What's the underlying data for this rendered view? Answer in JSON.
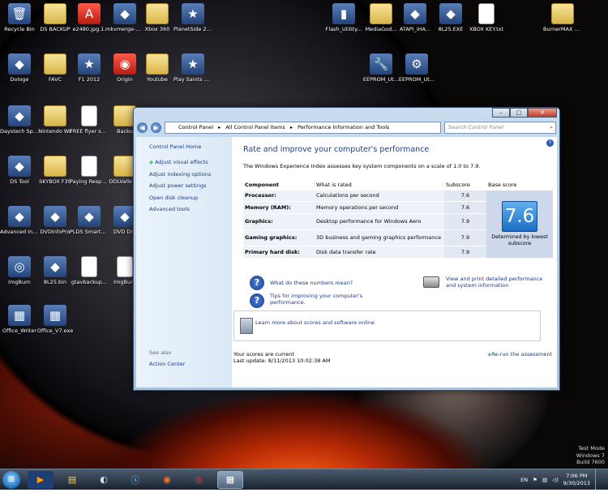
{
  "desktop_icons": [
    {
      "label": "Recycle Bin",
      "icon": "recycle-bin-icon"
    },
    {
      "label": "DS BACKUP",
      "icon": "folder-icon"
    },
    {
      "label": "e2480.jpg.1.",
      "icon": "pdf-icon"
    },
    {
      "label": "mkvmerge-GUI",
      "icon": "app-icon"
    },
    {
      "label": "Xbox 360",
      "icon": "folder-icon"
    },
    {
      "label": "PlanetSide 2 PS2",
      "icon": "game-icon"
    },
    {
      "label": "Flash_Utility...",
      "icon": "usb-icon"
    },
    {
      "label": "MediaGod...",
      "icon": "folder-icon"
    },
    {
      "label": "ATAPI_iHA...",
      "icon": "app-icon"
    },
    {
      "label": "8L25.EXE",
      "icon": "app-icon"
    },
    {
      "label": "XBOX KEY.txt",
      "icon": "text-file-icon"
    },
    {
      "label": "BurnerMAX v0.15",
      "icon": "folder-icon"
    },
    {
      "label": "Dologe",
      "icon": "app-icon"
    },
    {
      "label": "FAVC",
      "icon": "folder-icon"
    },
    {
      "label": "F1 2012",
      "icon": "game-icon"
    },
    {
      "label": "Origin",
      "icon": "origin-icon"
    },
    {
      "label": "Youtube",
      "icon": "folder-icon"
    },
    {
      "label": "Play Saints Row IV",
      "icon": "game-icon"
    },
    {
      "label": "EEPROM_Ut...",
      "icon": "wrench-icon"
    },
    {
      "label": "EEPROM_Ut...",
      "icon": "settings-file-icon"
    },
    {
      "label": "Daystech Specify...",
      "icon": "app-icon"
    },
    {
      "label": "Nintendo Wii",
      "icon": "folder-icon"
    },
    {
      "label": "FREE flyer sour.txt",
      "icon": "text-file-icon"
    },
    {
      "label": "Backu",
      "icon": "folder-icon"
    },
    {
      "label": "DS Tool",
      "icon": "app-icon"
    },
    {
      "label": "SKYBOX F3S",
      "icon": "folder-icon"
    },
    {
      "label": "Paying Respect At...",
      "icon": "text-file-icon"
    },
    {
      "label": "DDLValle 14",
      "icon": "folder-icon"
    },
    {
      "label": "Advanced Installer 10.0",
      "icon": "app-icon"
    },
    {
      "label": "DVDInfoPro",
      "icon": "app-icon"
    },
    {
      "label": "PLDS SmartPa...",
      "icon": "app-icon"
    },
    {
      "label": "DVD Dre",
      "icon": "app-icon"
    },
    {
      "label": "ImgBurn",
      "icon": "imgburn-icon"
    },
    {
      "label": "8L25.bin",
      "icon": "app-icon"
    },
    {
      "label": "gtavbackup...",
      "icon": "text-file-icon"
    },
    {
      "label": "ImgBurn",
      "icon": "text-file-icon"
    },
    {
      "label": "Office_Writer",
      "icon": "winrar-icon"
    },
    {
      "label": "Office_V7.exe",
      "icon": "winrar-icon"
    }
  ],
  "window": {
    "breadcrumbs": [
      "Control Panel",
      "All Control Panel Items",
      "Performance Information and Tools"
    ],
    "search_placeholder": "Search Control Panel",
    "sidebar": {
      "home": "Control Panel Home",
      "links": [
        "Adjust visual effects",
        "Adjust indexing options",
        "Adjust power settings",
        "Open disk cleanup",
        "Advanced tools"
      ],
      "see_also": "See also",
      "action_center": "Action Center"
    },
    "title": "Rate and improve your computer's performance",
    "description": "The Windows Experience Index assesses key system components on a scale of 1.0 to 7.9.",
    "table": {
      "headers": [
        "Component",
        "What is rated",
        "Subscore",
        "Base score"
      ],
      "rows": [
        {
          "component": "Processor:",
          "rated": "Calculations per second",
          "subscore": "7.6"
        },
        {
          "component": "Memory (RAM):",
          "rated": "Memory operations per second",
          "subscore": "7.6"
        },
        {
          "component": "Graphics:",
          "rated": "Desktop performance for Windows Aero",
          "subscore": "7.9"
        },
        {
          "component": "Gaming graphics:",
          "rated": "3D business and gaming graphics performance",
          "subscore": "7.9"
        },
        {
          "component": "Primary hard disk:",
          "rated": "Disk data transfer rate",
          "subscore": "7.9"
        }
      ],
      "base_score": "7.6",
      "base_caption": "Determined by lowest subscore"
    },
    "links": {
      "what_numbers": "What do these numbers mean?",
      "tips": "Tips for improving your computer's performance.",
      "print": "View and print detailed performance and system information",
      "learn": "Learn more about scores and software online"
    },
    "status": "Your scores are current",
    "last_update": "Last update: 8/11/2013 10:02:38 AM",
    "rerun": "Re-run the assessment"
  },
  "taskbar": {
    "lang": "EN",
    "time": "7:06 PM",
    "date": "9/30/2013"
  },
  "watermark": [
    "Test Mode",
    "Windows 7",
    "Build 7600"
  ]
}
